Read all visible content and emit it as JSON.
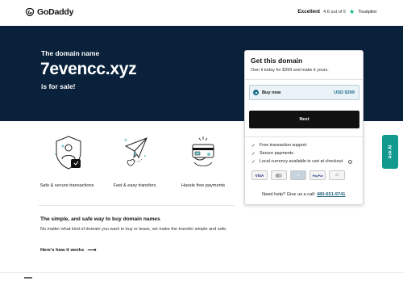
{
  "header": {
    "logo_text": "GoDaddy",
    "trust_rating_label": "Excellent",
    "trust_score": "4.6 out of 5",
    "trust_brand": "Trustpilot",
    "trust_color": "#00b67a"
  },
  "hero": {
    "eyebrow": "The domain name",
    "domain": "7evencc.xyz",
    "tagline": "is for sale!",
    "background": "#09213a"
  },
  "card": {
    "title": "Get this domain",
    "subtitle": "Own it today for $399 and make it yours.",
    "option_label": "Buy now",
    "option_price": "USD $399",
    "next_label": "Next",
    "features": [
      "Free transaction support",
      "Secure payments",
      "Local currency available in cart at checkout"
    ],
    "info_icon": "i",
    "payments": {
      "visa": "VISA",
      "paypal": "PayPal"
    }
  },
  "help": {
    "text": "Need help? Give us a call:",
    "phone": "480-651-9741"
  },
  "ask_ai": {
    "label": "Ask AI",
    "color": "#11998e"
  },
  "features_row": [
    {
      "label": "Safe & secure transactions",
      "icon": "shield-person-icon"
    },
    {
      "label": "Fast & easy transfers",
      "icon": "paper-plane-icon"
    },
    {
      "label": "Hassle free payments",
      "icon": "credit-card-icon"
    }
  ],
  "info_section": {
    "title": "The simple, and safe way to buy domain names",
    "text": "No matter what kind of domain you want to buy or lease, we make the transfer simple and safe.",
    "link": "Here's how it works"
  }
}
